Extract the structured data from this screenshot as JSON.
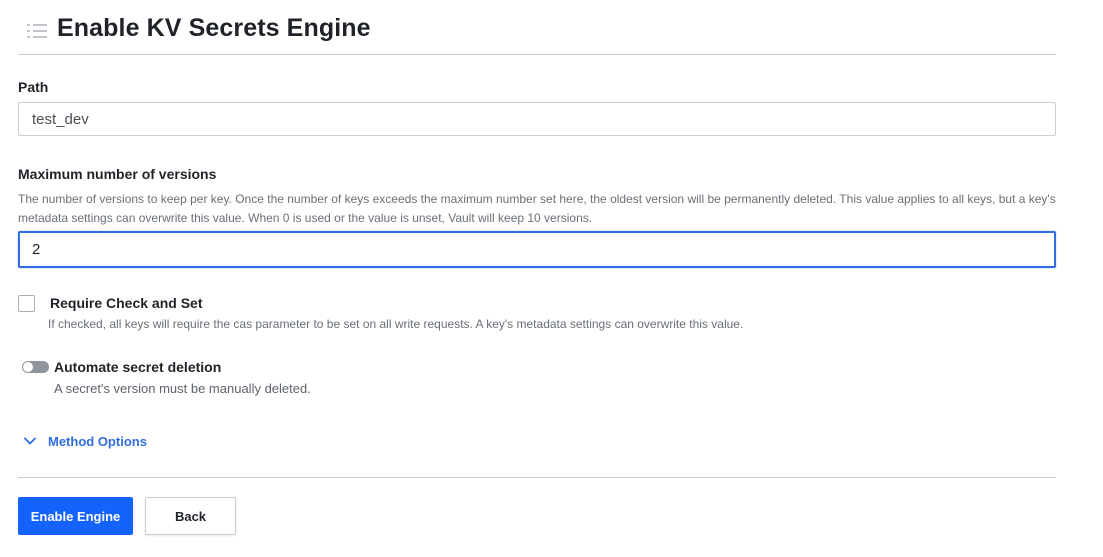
{
  "header": {
    "icon": "list-icon",
    "title": "Enable KV Secrets Engine"
  },
  "path": {
    "label": "Path",
    "value": "test_dev"
  },
  "max_versions": {
    "label": "Maximum number of versions",
    "help": "The number of versions to keep per key. Once the number of keys exceeds the maximum number set here, the oldest version will be permanently deleted. This value applies to all keys, but a key's metadata settings can overwrite this value. When 0 is used or the value is unset, Vault will keep 10 versions.",
    "value": "2"
  },
  "cas": {
    "label": "Require Check and Set",
    "help": "If checked, all keys will require the cas parameter to be set on all write requests. A key's metadata settings can overwrite this value.",
    "checked": false
  },
  "auto_delete": {
    "label": "Automate secret deletion",
    "help": "A secret's version must be manually deleted.",
    "enabled": false
  },
  "method_options": {
    "icon": "chevron-down-icon",
    "label": "Method Options"
  },
  "actions": {
    "enable_label": "Enable Engine",
    "back_label": "Back"
  },
  "colors": {
    "primary": "#1563ff",
    "link": "#2f6de1",
    "border": "#c9ced6",
    "focus": "#2f6de1"
  }
}
